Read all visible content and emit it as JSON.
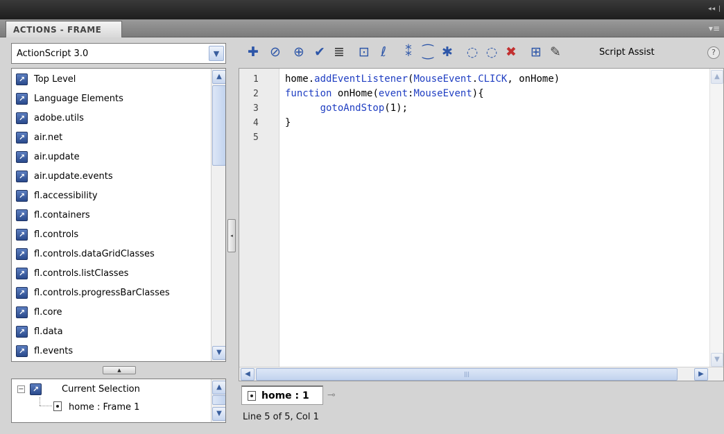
{
  "window": {
    "controls": "◂◂ |"
  },
  "panel": {
    "tab_title": "ACTIONS - FRAME",
    "menu_icon": "panel-menu-icon"
  },
  "language_select": {
    "value": "ActionScript 3.0"
  },
  "tree": {
    "items": [
      {
        "label": "Top Level"
      },
      {
        "label": "Language Elements"
      },
      {
        "label": "adobe.utils"
      },
      {
        "label": "air.net"
      },
      {
        "label": "air.update"
      },
      {
        "label": "air.update.events"
      },
      {
        "label": "fl.accessibility"
      },
      {
        "label": "fl.containers"
      },
      {
        "label": "fl.controls"
      },
      {
        "label": "fl.controls.dataGridClasses"
      },
      {
        "label": "fl.controls.listClasses"
      },
      {
        "label": "fl.controls.progressBarClasses"
      },
      {
        "label": "fl.core"
      },
      {
        "label": "fl.data"
      },
      {
        "label": "fl.events"
      }
    ]
  },
  "selection": {
    "root_label": "Current Selection",
    "child_label": "home : Frame 1"
  },
  "toolbar": {
    "icons": [
      "add-statement-icon",
      "find-icon",
      "insert-target-path-icon",
      "check-syntax-icon",
      "auto-format-icon",
      "show-code-hint-icon",
      "debug-options-icon",
      "collapse-between-braces-icon",
      "collapse-selection-icon",
      "expand-all-icon",
      "apply-block-comment-icon",
      "apply-line-comment-icon",
      "remove-comment-icon",
      "show-hide-toolbox-icon",
      "code-snippets-icon"
    ],
    "script_assist_label": "Script Assist",
    "help_label": "?"
  },
  "code": {
    "line_numbers": [
      "1",
      "2",
      "3",
      "4",
      "5"
    ],
    "lines": [
      {
        "parts": [
          {
            "t": "home.",
            "c": "plain"
          },
          {
            "t": "addEventListener",
            "c": "kw"
          },
          {
            "t": "(",
            "c": "plain"
          },
          {
            "t": "MouseEvent",
            "c": "kw"
          },
          {
            "t": ".",
            "c": "plain"
          },
          {
            "t": "CLICK",
            "c": "kw"
          },
          {
            "t": ", onHome)",
            "c": "plain"
          }
        ]
      },
      {
        "parts": [
          {
            "t": "function",
            "c": "kw"
          },
          {
            "t": " onHome(",
            "c": "plain"
          },
          {
            "t": "event",
            "c": "kw"
          },
          {
            "t": ":",
            "c": "plain"
          },
          {
            "t": "MouseEvent",
            "c": "kw"
          },
          {
            "t": "){",
            "c": "plain"
          }
        ]
      },
      {
        "parts": [
          {
            "t": "      ",
            "c": "plain"
          },
          {
            "t": "gotoAndStop",
            "c": "kw"
          },
          {
            "t": "(1);",
            "c": "plain"
          }
        ]
      },
      {
        "parts": [
          {
            "t": "}",
            "c": "plain"
          }
        ]
      },
      {
        "parts": []
      }
    ],
    "keyword_color": "#1f3ec2"
  },
  "script_tab": {
    "label": "home : 1"
  },
  "status": {
    "text": "Line 5 of 5, Col 1"
  }
}
